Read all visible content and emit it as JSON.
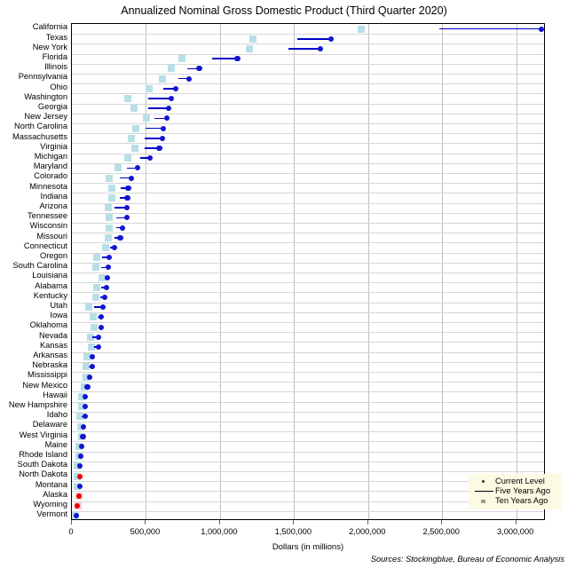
{
  "chart_data": {
    "type": "scatter",
    "title": "Annualized Nominal Gross Domestic Product (Third Quarter 2020)",
    "xlabel": "Dollars (in millions)",
    "ylabel": "",
    "xlim": [
      0,
      3200000
    ],
    "xticks": [
      0,
      500000,
      1000000,
      1500000,
      2000000,
      2500000,
      3000000
    ],
    "xticklabels": [
      "0",
      "500,000",
      "1,000,000",
      "1,500,000",
      "2,000,000",
      "2,500,000",
      "3,000,000"
    ],
    "grid": true,
    "legend_position": "bottom-right",
    "sources": "Sources: Stockingblue, Bureau of Economic Analysis",
    "legend": [
      {
        "label": "Current Level",
        "marker": "dot",
        "color": "#1414d2"
      },
      {
        "label": "Five Years Ago",
        "marker": "line",
        "color": "#0000cc"
      },
      {
        "label": "Ten Years Ago",
        "marker": "square",
        "color": "#b8dfe6"
      }
    ],
    "series": [
      {
        "name": "Current Level",
        "marker": "dot"
      },
      {
        "name": "Five Years Ago",
        "marker": "line"
      },
      {
        "name": "Ten Years Ago",
        "marker": "square"
      }
    ],
    "categories": [
      "California",
      "Texas",
      "New York",
      "Florida",
      "Illinois",
      "Pennsylvania",
      "Ohio",
      "Washington",
      "Georgia",
      "New Jersey",
      "North Carolina",
      "Massachusetts",
      "Virginia",
      "Michigan",
      "Maryland",
      "Colorado",
      "Minnesota",
      "Indiana",
      "Arizona",
      "Tennessee",
      "Wisconsin",
      "Missouri",
      "Connecticut",
      "Oregon",
      "South Carolina",
      "Louisiana",
      "Alabama",
      "Kentucky",
      "Utah",
      "Iowa",
      "Oklahoma",
      "Nevada",
      "Kansas",
      "Arkansas",
      "Nebraska",
      "Mississippi",
      "New Mexico",
      "Hawaii",
      "New Hampshire",
      "Idaho",
      "Delaware",
      "West Virginia",
      "Maine",
      "Rhode Island",
      "South Dakota",
      "North Dakota",
      "Montana",
      "Alaska",
      "Wyoming",
      "Vermont"
    ],
    "rows": [
      {
        "state": "California",
        "current": 3170000,
        "five": 2480000,
        "ten": 1955000,
        "declined": false
      },
      {
        "state": "Texas",
        "current": 1750000,
        "five": 1520000,
        "ten": 1225000,
        "declined": false
      },
      {
        "state": "New York",
        "current": 1680000,
        "five": 1465000,
        "ten": 1200000,
        "declined": false
      },
      {
        "state": "Florida",
        "current": 1118000,
        "five": 947000,
        "ten": 745000,
        "declined": false
      },
      {
        "state": "Illinois",
        "current": 860000,
        "five": 780000,
        "ten": 672000,
        "declined": false
      },
      {
        "state": "Pennsylvania",
        "current": 790000,
        "five": 722000,
        "ten": 610000,
        "declined": false
      },
      {
        "state": "Ohio",
        "current": 700000,
        "five": 615000,
        "ten": 520000,
        "declined": false
      },
      {
        "state": "Washington",
        "current": 670000,
        "five": 516000,
        "ten": 377000,
        "declined": false
      },
      {
        "state": "Georgia",
        "current": 652000,
        "five": 518000,
        "ten": 418000,
        "declined": false
      },
      {
        "state": "New Jersey",
        "current": 640000,
        "five": 560000,
        "ten": 503000,
        "declined": false
      },
      {
        "state": "North Carolina",
        "current": 616000,
        "five": 500000,
        "ten": 430000,
        "declined": false
      },
      {
        "state": "Massachusetts",
        "current": 610000,
        "five": 490000,
        "ten": 400000,
        "declined": false
      },
      {
        "state": "Virginia",
        "current": 590000,
        "five": 493000,
        "ten": 425000,
        "declined": false
      },
      {
        "state": "Michigan",
        "current": 525000,
        "five": 463000,
        "ten": 380000,
        "declined": false
      },
      {
        "state": "Maryland",
        "current": 445000,
        "five": 372000,
        "ten": 312000,
        "declined": false
      },
      {
        "state": "Colorado",
        "current": 400000,
        "five": 325000,
        "ten": 253000,
        "declined": false
      },
      {
        "state": "Minnesota",
        "current": 380000,
        "five": 330000,
        "ten": 272000,
        "declined": false
      },
      {
        "state": "Indiana",
        "current": 375000,
        "five": 325000,
        "ten": 268000,
        "declined": false
      },
      {
        "state": "Arizona",
        "current": 372000,
        "five": 285000,
        "ten": 248000,
        "declined": false
      },
      {
        "state": "Tennessee",
        "current": 370000,
        "five": 302000,
        "ten": 250000,
        "declined": false
      },
      {
        "state": "Wisconsin",
        "current": 342000,
        "five": 300000,
        "ten": 250000,
        "declined": false
      },
      {
        "state": "Missouri",
        "current": 327000,
        "five": 287000,
        "ten": 245000,
        "declined": false
      },
      {
        "state": "Connecticut",
        "current": 288000,
        "five": 255000,
        "ten": 230000,
        "declined": false
      },
      {
        "state": "Oregon",
        "current": 253000,
        "five": 205000,
        "ten": 167000,
        "declined": false
      },
      {
        "state": "South Carolina",
        "current": 248000,
        "five": 200000,
        "ten": 160000,
        "declined": false
      },
      {
        "state": "Louisiana",
        "current": 242000,
        "five": 220000,
        "ten": 205000,
        "declined": false
      },
      {
        "state": "Alabama",
        "current": 235000,
        "five": 200000,
        "ten": 170000,
        "declined": false
      },
      {
        "state": "Kentucky",
        "current": 220000,
        "five": 192000,
        "ten": 162000,
        "declined": false
      },
      {
        "state": "Utah",
        "current": 208000,
        "five": 150000,
        "ten": 115000,
        "declined": false
      },
      {
        "state": "Iowa",
        "current": 200000,
        "five": 175000,
        "ten": 145000,
        "declined": false
      },
      {
        "state": "Oklahoma",
        "current": 197000,
        "five": 185000,
        "ten": 150000,
        "declined": false
      },
      {
        "state": "Nevada",
        "current": 180000,
        "five": 140000,
        "ten": 123000,
        "declined": false
      },
      {
        "state": "Kansas",
        "current": 178000,
        "five": 152000,
        "ten": 130000,
        "declined": false
      },
      {
        "state": "Arkansas",
        "current": 140000,
        "five": 122000,
        "ten": 103000,
        "declined": false
      },
      {
        "state": "Nebraska",
        "current": 138000,
        "five": 115000,
        "ten": 95000,
        "declined": false
      },
      {
        "state": "Mississippi",
        "current": 118000,
        "five": 105000,
        "ten": 95000,
        "declined": false
      },
      {
        "state": "New Mexico",
        "current": 105000,
        "five": 92000,
        "ten": 83000,
        "declined": false
      },
      {
        "state": "Hawaii",
        "current": 92000,
        "five": 80000,
        "ten": 67000,
        "declined": false
      },
      {
        "state": "New Hampshire",
        "current": 89000,
        "five": 75000,
        "ten": 63000,
        "declined": false
      },
      {
        "state": "Idaho",
        "current": 88000,
        "five": 65000,
        "ten": 54000,
        "declined": false
      },
      {
        "state": "Delaware",
        "current": 78000,
        "five": 65000,
        "ten": 61000,
        "declined": false
      },
      {
        "state": "West Virginia",
        "current": 75000,
        "five": 72000,
        "ten": 65000,
        "declined": false
      },
      {
        "state": "Maine",
        "current": 68000,
        "five": 57000,
        "ten": 50000,
        "declined": false
      },
      {
        "state": "Rhode Island",
        "current": 62000,
        "five": 54000,
        "ten": 48000,
        "declined": false
      },
      {
        "state": "South Dakota",
        "current": 55000,
        "five": 46000,
        "ten": 38000,
        "declined": false
      },
      {
        "state": "North Dakota",
        "current": 52000,
        "five": 53000,
        "ten": 37000,
        "declined": true
      },
      {
        "state": "Montana",
        "current": 52000,
        "five": 44000,
        "ten": 36000,
        "declined": false
      },
      {
        "state": "Alaska",
        "current": 48000,
        "five": 52000,
        "ten": 50000,
        "declined": true
      },
      {
        "state": "Wyoming",
        "current": 36000,
        "five": 41000,
        "ten": 39000,
        "declined": true
      },
      {
        "state": "Vermont",
        "current": 32000,
        "five": 28000,
        "ten": 25000,
        "declined": false
      }
    ]
  },
  "title": "Annualized Nominal Gross Domestic Product (Third Quarter 2020)",
  "xaxis_title": "Dollars (in millions)",
  "sources": "Sources: Stockingblue, Bureau of Economic Analysis",
  "legend": {
    "current": "Current Level",
    "five": "Five Years Ago",
    "ten": "Ten Years Ago"
  }
}
